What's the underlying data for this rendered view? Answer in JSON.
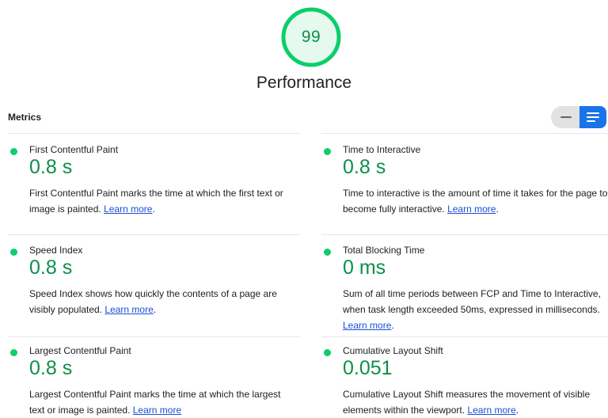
{
  "score": {
    "value": "99",
    "color": "#0cce6b"
  },
  "category_title": "Performance",
  "metrics_header": "Metrics",
  "view_toggle": {
    "left_icon": "collapse-lines-icon",
    "right_icon": "expand-lines-icon",
    "active": "right"
  },
  "metrics": [
    {
      "name": "First Contentful Paint",
      "value": "0.8 s",
      "desc": "First Contentful Paint marks the time at which the first text or image is painted.",
      "link": "Learn more",
      "status_color": "#0cce6b"
    },
    {
      "name": "Time to Interactive",
      "value": "0.8 s",
      "desc": "Time to interactive is the amount of time it takes for the page to become fully interactive.",
      "link": "Learn more",
      "status_color": "#0cce6b"
    },
    {
      "name": "Speed Index",
      "value": "0.8 s",
      "desc": "Speed Index shows how quickly the contents of a page are visibly populated.",
      "link": "Learn more",
      "status_color": "#0cce6b"
    },
    {
      "name": "Total Blocking Time",
      "value": "0 ms",
      "desc": "Sum of all time periods between FCP and Time to Interactive, when task length exceeded 50ms, expressed in milliseconds.",
      "link": "Learn more",
      "status_color": "#0cce6b"
    },
    {
      "name": "Largest Contentful Paint",
      "value": "0.8 s",
      "desc": "Largest Contentful Paint marks the time at which the largest text or image is painted.",
      "link": "Learn more",
      "status_color": "#0cce6b"
    },
    {
      "name": "Cumulative Layout Shift",
      "value": "0.051",
      "desc": "Cumulative Layout Shift measures the movement of visible elements within the viewport.",
      "link": "Learn more",
      "status_color": "#0cce6b"
    }
  ]
}
